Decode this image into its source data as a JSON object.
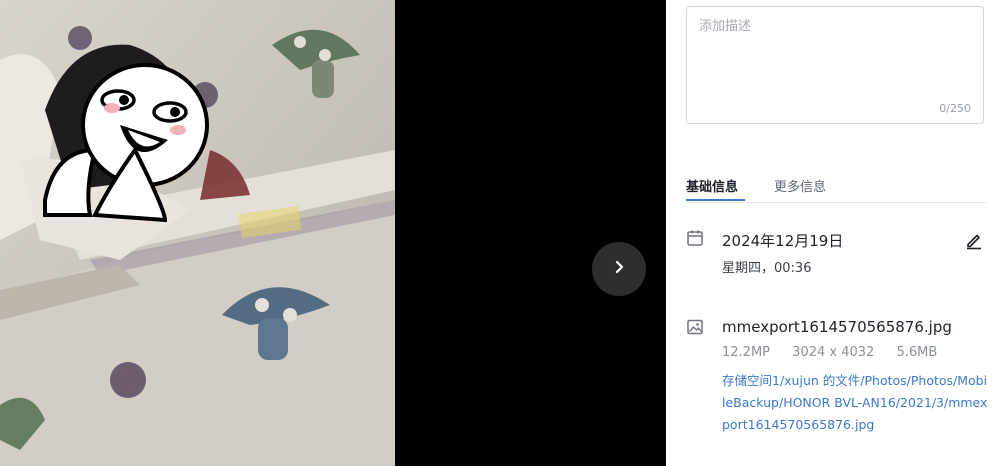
{
  "viewer": {
    "next_icon": "chevron-right-icon"
  },
  "panel": {
    "description": {
      "placeholder": "添加描述",
      "counter": "0/250"
    },
    "tabs": [
      {
        "label": "基础信息",
        "active": true
      },
      {
        "label": "更多信息",
        "active": false
      }
    ],
    "date": {
      "icon": "calendar-icon",
      "main": "2024年12月19日",
      "sub": "星期四，00:36",
      "edit_icon": "pencil-icon"
    },
    "file": {
      "icon": "image-icon",
      "name": "mmexport1614570565876.jpg",
      "megapixels": "12.2MP",
      "dimensions": "3024 x 4032",
      "size": "5.6MB",
      "path": "存储空间1/xujun 的文件/Photos/Photos/MobileBackup/HONOR BVL-AN16/2021/3/mmexport1614570565876.jpg"
    }
  },
  "colors": {
    "accent": "#3c7ad6",
    "link": "#3c78c8",
    "viewer_bg": "#000000"
  }
}
